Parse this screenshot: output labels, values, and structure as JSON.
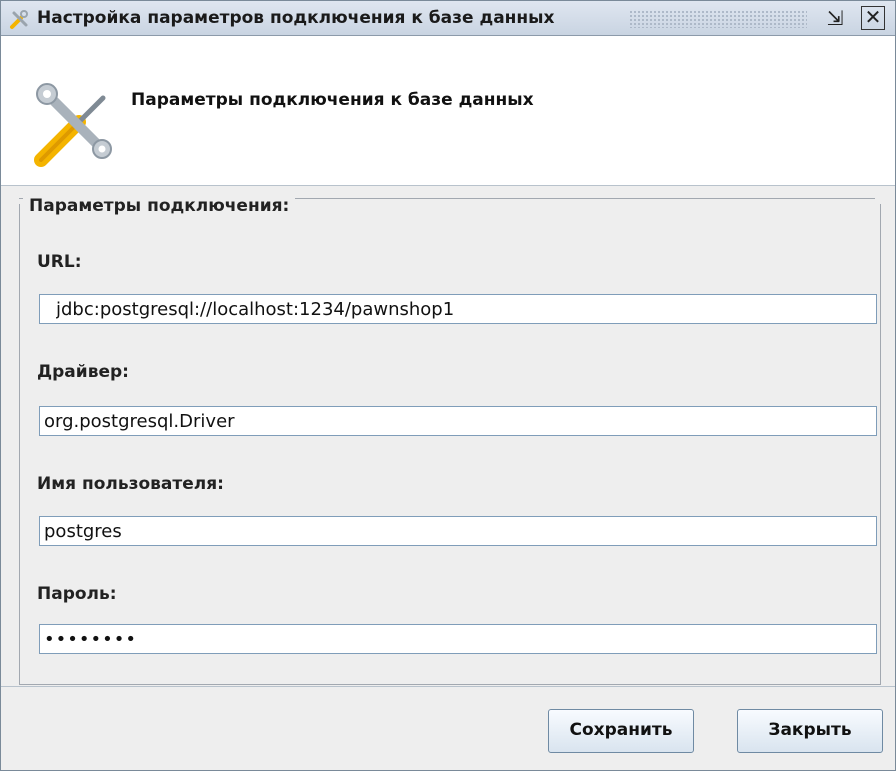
{
  "window": {
    "title": "Настройка параметров подключения к базе данных",
    "header": "Параметры подключения к базе данных"
  },
  "form": {
    "group_title": "Параметры подключения:",
    "url_label": "URL:",
    "url_value": "jdbc:postgresql://localhost:1234/pawnshop1",
    "driver_label": "Драйвер:",
    "driver_value": "org.postgresql.Driver",
    "user_label": "Имя пользователя:",
    "user_value": "postgres",
    "password_label": "Пароль:",
    "password_value": "••••••••"
  },
  "buttons": {
    "save": "Сохранить",
    "close": "Закрыть"
  },
  "icons": {
    "app": "tools-icon",
    "header": "wrench-screwdriver-icon",
    "restore": "restore-window-icon",
    "close": "close-window-icon"
  }
}
